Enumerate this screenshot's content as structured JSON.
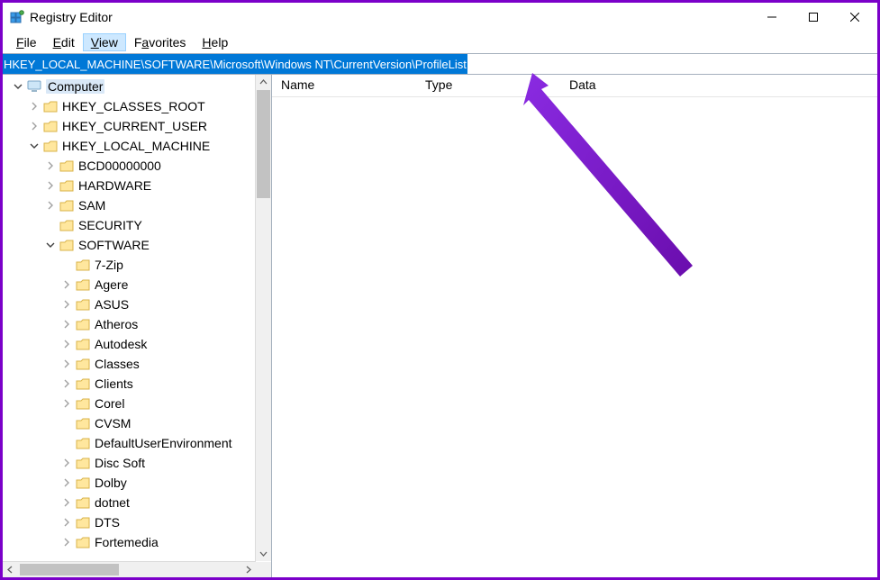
{
  "window": {
    "title": "Registry Editor"
  },
  "menu": {
    "file": "File",
    "edit": "Edit",
    "view": "View",
    "favorites": "Favorites",
    "help": "Help"
  },
  "address": {
    "path": "HKEY_LOCAL_MACHINE\\SOFTWARE\\Microsoft\\Windows NT\\CurrentVersion\\ProfileList"
  },
  "tree": {
    "root": "Computer",
    "hkcr": "HKEY_CLASSES_ROOT",
    "hkcu": "HKEY_CURRENT_USER",
    "hklm": "HKEY_LOCAL_MACHINE",
    "hklm_children": {
      "bcd": "BCD00000000",
      "hardware": "HARDWARE",
      "sam": "SAM",
      "security": "SECURITY",
      "software": "SOFTWARE"
    },
    "software_children": {
      "sevenzip": "7-Zip",
      "agere": "Agere",
      "asus": "ASUS",
      "atheros": "Atheros",
      "autodesk": "Autodesk",
      "classes": "Classes",
      "clients": "Clients",
      "corel": "Corel",
      "cvsm": "CVSM",
      "defaultuserenv": "DefaultUserEnvironment",
      "discsoft": "Disc Soft",
      "dolby": "Dolby",
      "dotnet": "dotnet",
      "dts": "DTS",
      "fortemedia": "Fortemedia"
    }
  },
  "list": {
    "col_name": "Name",
    "col_type": "Type",
    "col_data": "Data"
  }
}
